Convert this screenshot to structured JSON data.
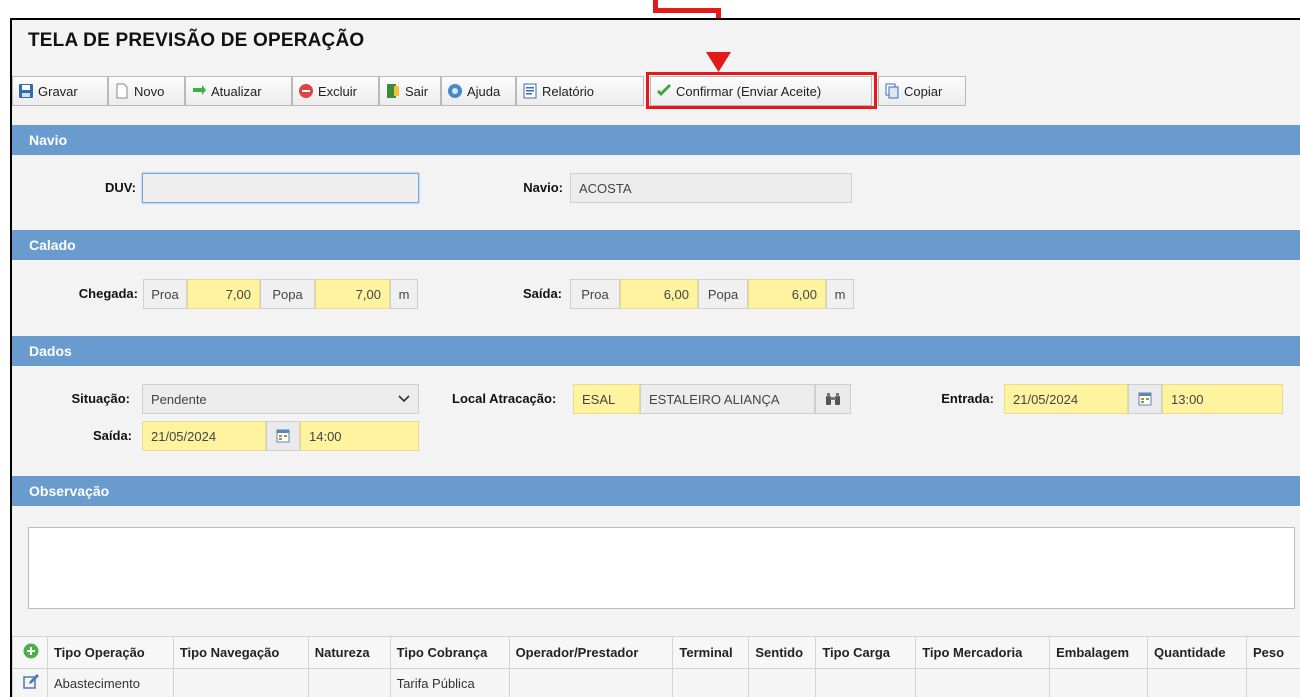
{
  "page": {
    "title": "TELA DE PREVISÃO DE OPERAÇÃO"
  },
  "toolbar": {
    "gravar": "Gravar",
    "novo": "Novo",
    "atualizar": "Atualizar",
    "excluir": "Excluir",
    "sair": "Sair",
    "ajuda": "Ajuda",
    "relatorio": "Relatório",
    "confirmar": "Confirmar (Enviar Aceite)",
    "copiar": "Copiar"
  },
  "navio": {
    "header": "Navio",
    "duv_label": "DUV:",
    "duv_value": "",
    "navio_label": "Navio:",
    "navio_value": "ACOSTA"
  },
  "calado": {
    "header": "Calado",
    "chegada_label": "Chegada:",
    "saida_label": "Saída:",
    "proa_label": "Proa",
    "popa_label": "Popa",
    "unit": "m",
    "chegada_proa": "7,00",
    "chegada_popa": "7,00",
    "saida_proa": "6,00",
    "saida_popa": "6,00"
  },
  "dados": {
    "header": "Dados",
    "situacao_label": "Situação:",
    "situacao_value": "Pendente",
    "local_label": "Local Atracação:",
    "local_code": "ESAL",
    "local_name": "ESTALEIRO ALIANÇA",
    "entrada_label": "Entrada:",
    "entrada_date": "21/05/2024",
    "entrada_time": "13:00",
    "saida_label": "Saída:",
    "saida_date": "21/05/2024",
    "saida_time": "14:00"
  },
  "observacao": {
    "header": "Observação",
    "value": ""
  },
  "grid": {
    "columns": [
      "Tipo Operação",
      "Tipo Navegação",
      "Natureza",
      "Tipo Cobrança",
      "Operador/Prestador",
      "Terminal",
      "Sentido",
      "Tipo Carga",
      "Tipo Mercadoria",
      "Embalagem",
      "Quantidade",
      "Peso"
    ],
    "rows": [
      {
        "tipo_operacao": "Abastecimento",
        "tipo_navegacao": "",
        "natureza": "",
        "tipo_cobranca": "Tarifa Pública",
        "operador": "",
        "terminal": "",
        "sentido": "",
        "tipo_carga": "",
        "tipo_mercadoria": "",
        "embalagem": "",
        "quantidade": "",
        "peso": ""
      }
    ]
  },
  "colors": {
    "section_header": "#6a9bcf",
    "required_field": "#fff3a0",
    "annotation": "#e31a1a"
  }
}
